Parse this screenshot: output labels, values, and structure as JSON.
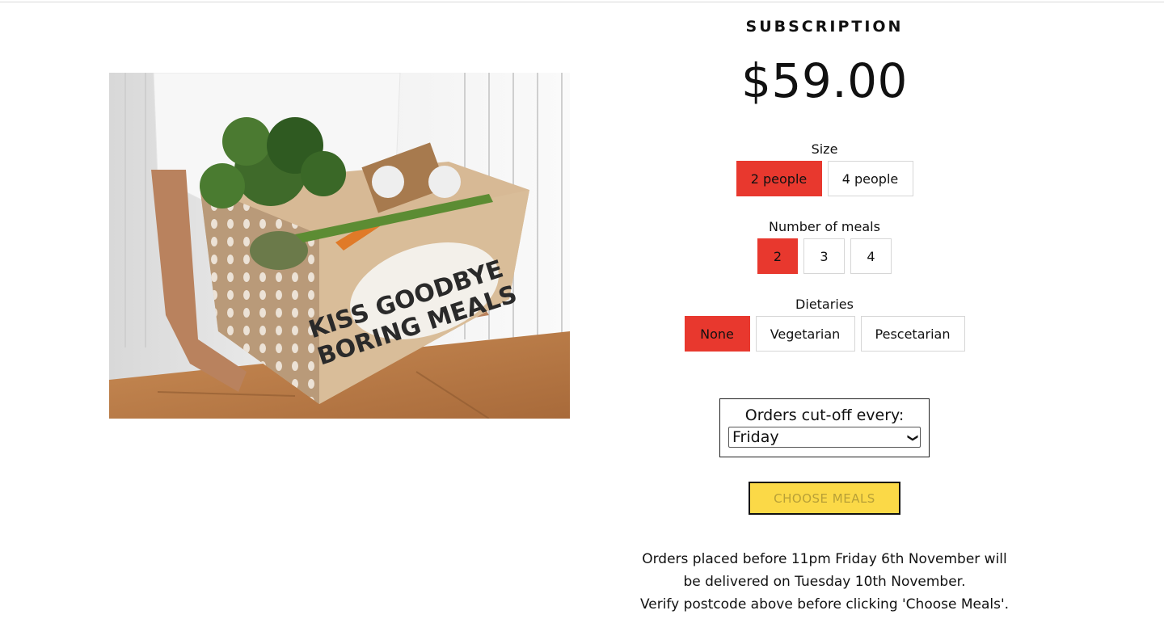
{
  "product": {
    "title": "SUBSCRIPTION",
    "price": "$59.00",
    "image_text": [
      "KISS GOODBYE",
      "BORING MEALS"
    ]
  },
  "options": {
    "size": {
      "label": "Size",
      "choices": [
        "2 people",
        "4 people"
      ],
      "selected": "2 people"
    },
    "meals": {
      "label": "Number of meals",
      "choices": [
        "2",
        "3",
        "4"
      ],
      "selected": "2"
    },
    "dietaries": {
      "label": "Dietaries",
      "choices": [
        "None",
        "Vegetarian",
        "Pescetarian"
      ],
      "selected": "None"
    }
  },
  "cutoff": {
    "label": "Orders cut-off every:",
    "selected": "Friday"
  },
  "choose_button": "CHOOSE MEALS",
  "delivery_info": [
    "Orders placed before 11pm Friday 6th November will",
    "be delivered on Tuesday 10th November.",
    "Verify postcode above before clicking 'Choose Meals'."
  ],
  "colors": {
    "selected": "#e8382e",
    "button": "#fbd947"
  }
}
